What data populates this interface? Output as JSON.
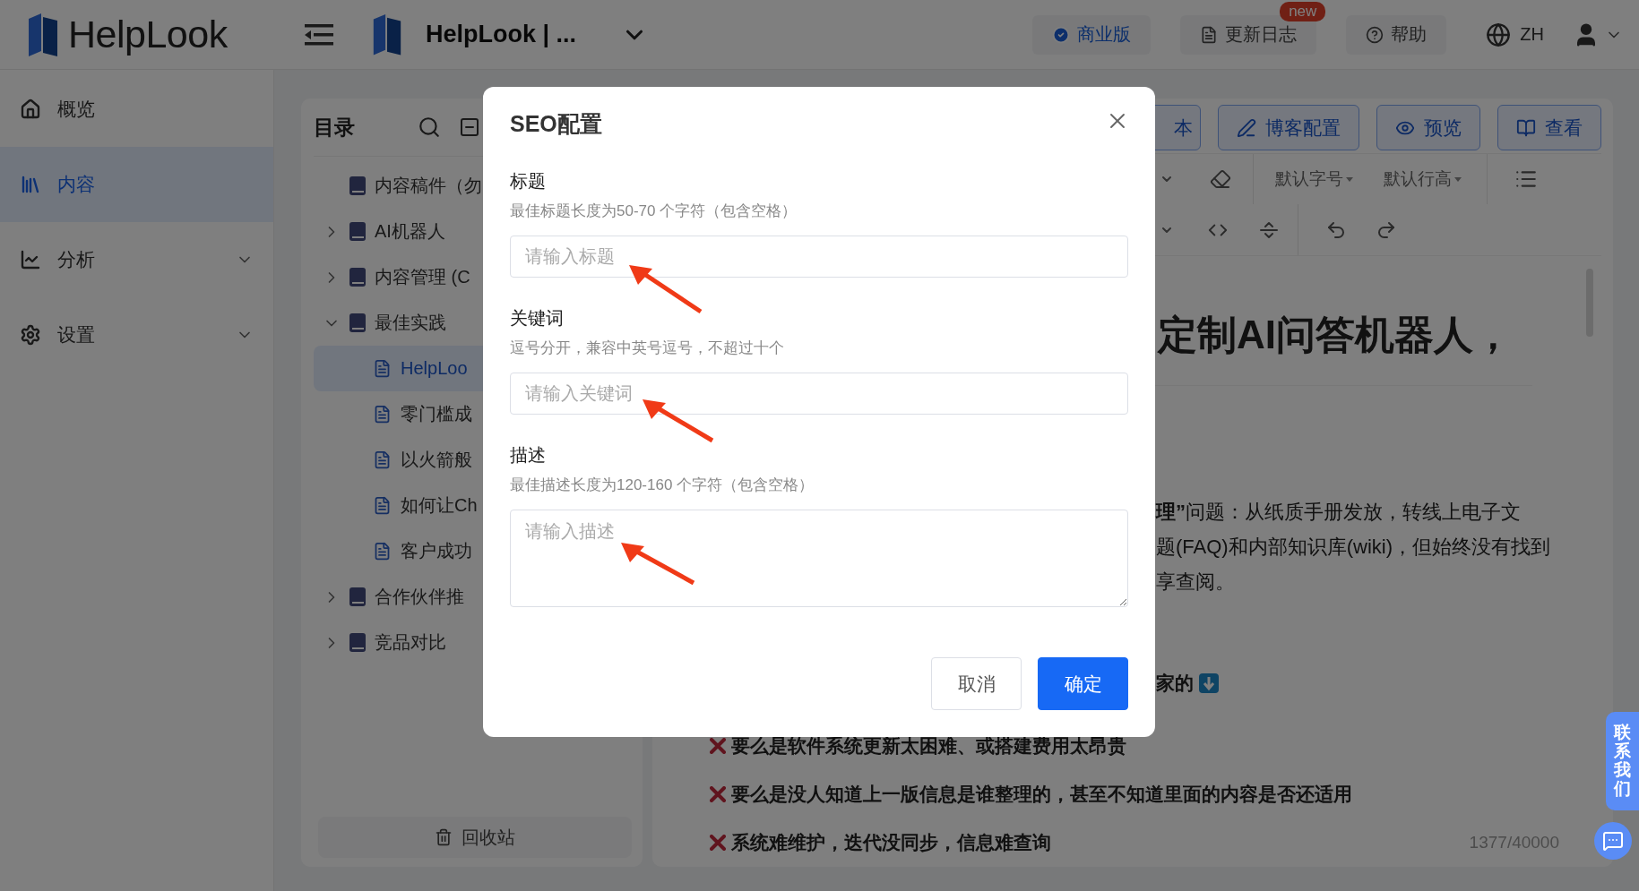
{
  "topbar": {
    "logo": "HelpLook",
    "site": "HelpLook | ...",
    "actions": [
      {
        "label": "商业版",
        "highlighted": true
      },
      {
        "label": "更新日志",
        "highlighted": false,
        "badge": "new"
      },
      {
        "label": "帮助",
        "highlighted": false
      }
    ],
    "language": "ZH"
  },
  "sidebar": {
    "items": [
      {
        "label": "概览",
        "kind": "link",
        "selected": false
      },
      {
        "label": "内容",
        "kind": "link",
        "selected": true
      },
      {
        "label": "分析",
        "kind": "group",
        "selected": false,
        "expanded": false
      },
      {
        "label": "设置",
        "kind": "group",
        "selected": false,
        "expanded": false
      }
    ]
  },
  "tree": {
    "title": "目录",
    "items": [
      {
        "label": "内容稿件（勿",
        "kind": "book",
        "selected": false
      },
      {
        "label": "AI机器人",
        "kind": "folder",
        "selected": false,
        "expanded": false
      },
      {
        "label": "内容管理 (C",
        "kind": "folder",
        "selected": false,
        "expanded": false
      },
      {
        "label": "最佳实践",
        "kind": "folder",
        "selected": false,
        "expanded": true,
        "children": [
          {
            "label": "HelpLoo",
            "kind": "doc",
            "selected": true
          },
          {
            "label": "零门槛成",
            "kind": "doc",
            "selected": false
          },
          {
            "label": "以火箭般",
            "kind": "doc",
            "selected": false
          },
          {
            "label": "如何让Ch",
            "kind": "doc",
            "selected": false
          },
          {
            "label": "客户成功",
            "kind": "doc",
            "selected": false
          }
        ]
      },
      {
        "label": "合作伙伴推",
        "kind": "folder",
        "selected": false,
        "expanded": false
      },
      {
        "label": "竞品对比",
        "kind": "folder",
        "selected": false,
        "expanded": false
      }
    ],
    "recycle": "回收站"
  },
  "editor": {
    "buttons": [
      "本",
      "博客配置",
      "预览",
      "查看"
    ],
    "dropdowns": [
      "默认字号",
      "默认行高"
    ],
    "heading": "定制AI问答机器人，",
    "paragraph": [
      "**理”**问题：从纸质手册发放，转线上电子文",
      "题(FAQ)和内部知识库(wiki)，但始终没有找到",
      "享查阅。"
    ],
    "lead": "家的",
    "list": [
      "要么是软件系统更新太困难、或搭建费用太昂贵",
      " 要么是没人知道上一版信息是谁整理的，甚至不知道里面的内容是否还适用",
      "系统难维护，迭代没同步，信息难查询"
    ],
    "counter": "1377/40000"
  },
  "contact": "联系我们",
  "dialog": {
    "title": "SEO配置",
    "fields": [
      {
        "label": "标题",
        "hint": "最佳标题长度为50-70 个字符（包含空格）",
        "placeholder": "请输入标题",
        "kind": "input"
      },
      {
        "label": "关键词",
        "hint": "逗号分开，兼容中英号逗号，不超过十个",
        "placeholder": "请输入关键词",
        "kind": "input"
      },
      {
        "label": "描述",
        "hint": "最佳描述长度为120-160 个字符（包含空格）",
        "placeholder": "请输入描述",
        "kind": "textarea"
      }
    ],
    "buttons": [
      {
        "label": "取消",
        "primary": false
      },
      {
        "label": "确定",
        "primary": true
      }
    ]
  }
}
